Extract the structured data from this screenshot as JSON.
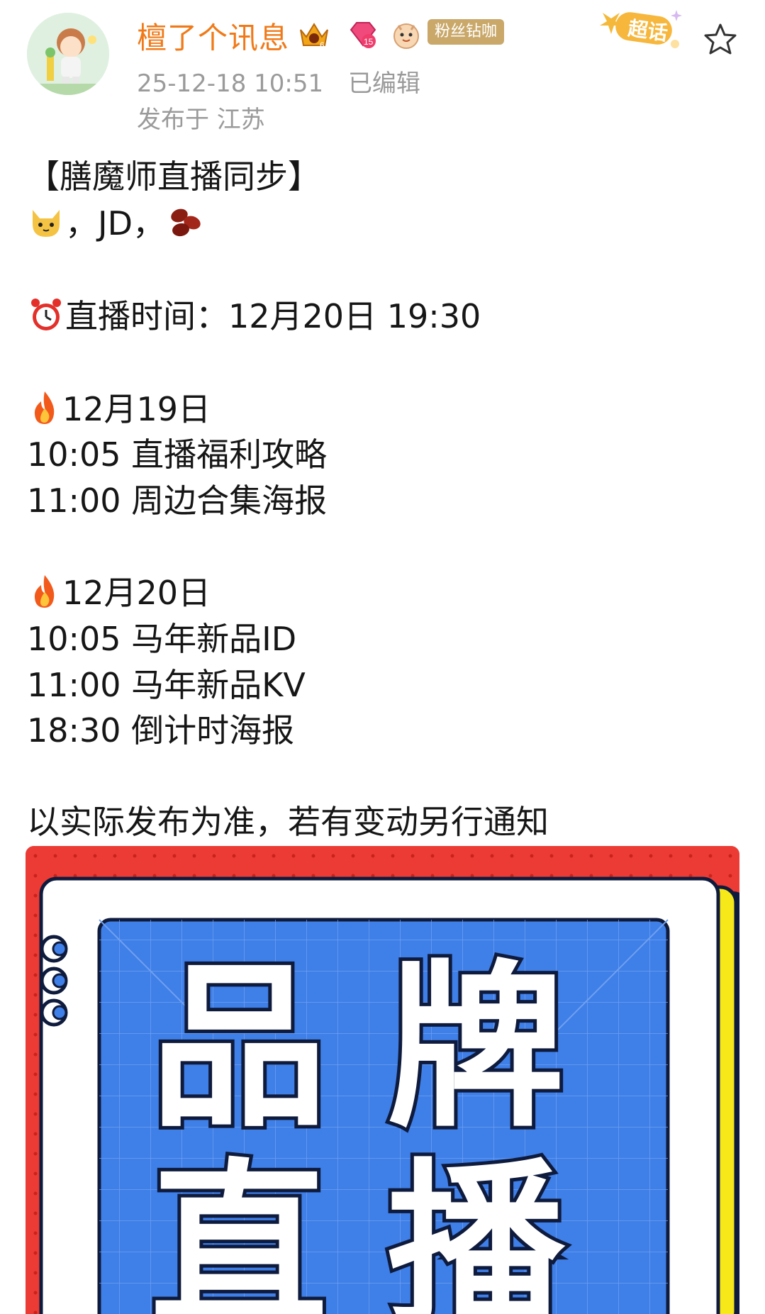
{
  "post": {
    "username": "檀了个讯息",
    "fan_badge": "粉丝钻咖",
    "badges": [
      "crown-level-icon",
      "diamond-15-icon",
      "mascot-icon"
    ],
    "chaohua_label": "超话",
    "timestamp": "25-12-18 10:51",
    "edited": "已编辑",
    "location": "发布于 江苏",
    "lines": {
      "title": "【膳魔师直播同步】",
      "platforms": "，JD，",
      "live_time": "直播时间：12月20日 19:30",
      "day1": "12月19日",
      "day1_item1": "10:05 直播福利攻略",
      "day1_item2": "11:00  周边合集海报",
      "day2": "12月20日",
      "day2_item1": "10:05 马年新品ID",
      "day2_item2": "11:00 马年新品KV",
      "day2_item3": "18:30 倒计时海报",
      "footer": "以实际发布为准，若有变动另行通知"
    }
  },
  "poster": {
    "line1_a": "品",
    "line1_b": "牌",
    "line2_a": "直",
    "line2_b": "播",
    "colors": {
      "red": "#ec3b34",
      "blue": "#3f7fe8",
      "yellow": "#f7e81a",
      "white": "#ffffff",
      "navy": "#0f1b3d"
    }
  }
}
